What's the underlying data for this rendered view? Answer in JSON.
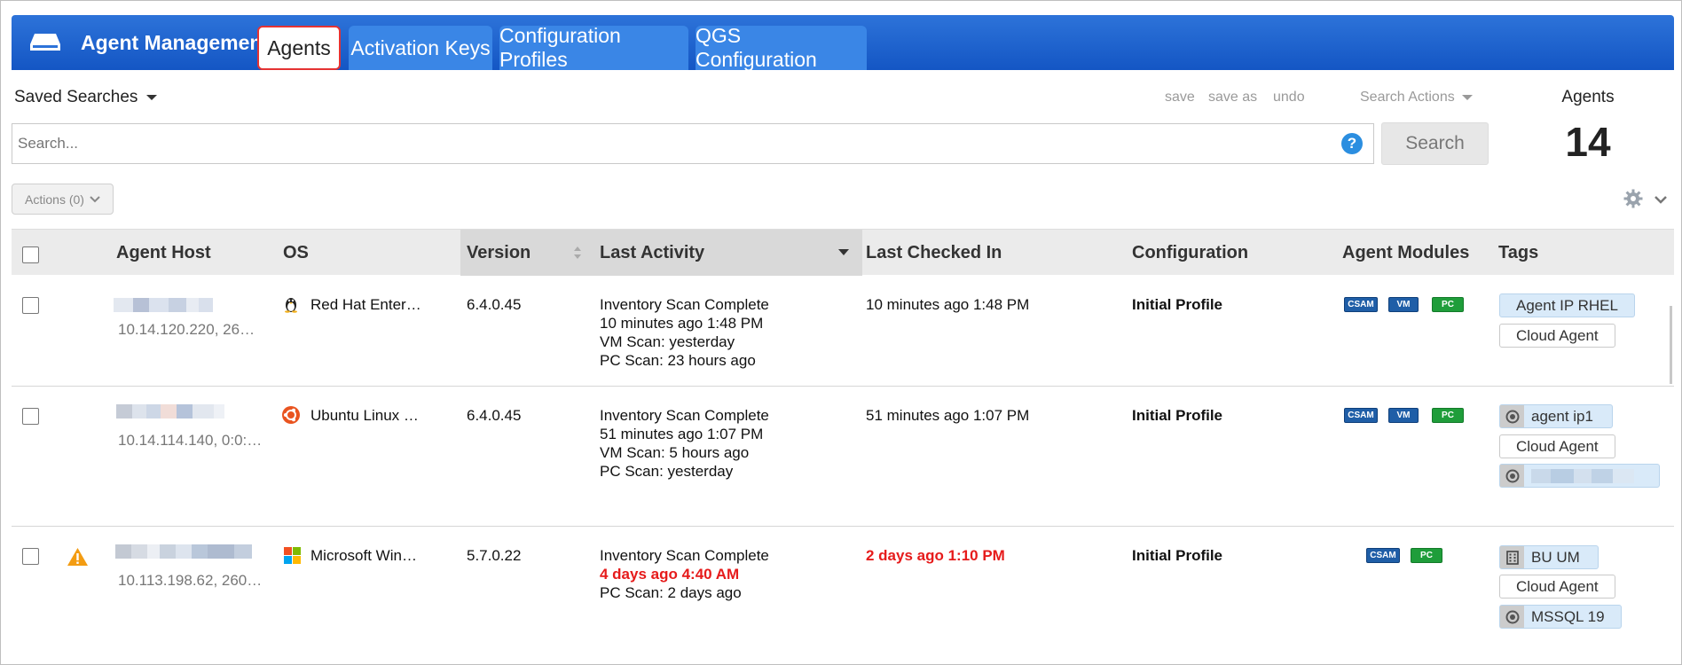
{
  "header": {
    "app_title": "Agent Management",
    "tabs": [
      {
        "label": "Agents",
        "active": true
      },
      {
        "label": "Activation Keys"
      },
      {
        "label": "Configuration Profiles"
      },
      {
        "label": "QGS Configuration"
      }
    ],
    "brand_color": "#1a5fcf",
    "logo_icon": "device-icon"
  },
  "toolbar": {
    "saved_searches": "Saved Searches",
    "save": "save",
    "save_as": "save as",
    "undo": "undo",
    "search_actions": "Search Actions",
    "search_placeholder": "Search...",
    "search_button": "Search",
    "actions_button": "Actions (0)",
    "help_glyph": "?"
  },
  "summary": {
    "agents_label": "Agents",
    "agents_count": "14"
  },
  "table": {
    "columns": [
      "Agent Host",
      "OS",
      "Version",
      "Last Activity",
      "Last Checked In",
      "Configuration",
      "Agent Modules",
      "Tags"
    ],
    "sorted_column": "Last Activity",
    "rows": [
      {
        "host_ip": "10.14.120.220, 26…",
        "warning": false,
        "os_icon": "linux-tux-icon",
        "os": "Red Hat Enter…",
        "version": "6.4.0.45",
        "activity": [
          "Inventory Scan Complete",
          "10 minutes ago 1:48 PM",
          "VM Scan: yesterday",
          "PC Scan: 23 hours ago"
        ],
        "checked_in": "10 minutes ago 1:48 PM",
        "checked_in_stale": false,
        "configuration": "Initial Profile",
        "modules": [
          "CSAM",
          "VM",
          "PC"
        ],
        "tags": [
          "Agent IP RHEL",
          "Cloud Agent"
        ]
      },
      {
        "host_ip": "10.14.114.140, 0:0:…",
        "warning": false,
        "os_icon": "ubuntu-icon",
        "os": "Ubuntu Linux …",
        "version": "6.4.0.45",
        "activity": [
          "Inventory Scan Complete",
          "51 minutes ago 1:07 PM",
          "VM Scan: 5 hours ago",
          "PC Scan: yesterday"
        ],
        "checked_in": "51 minutes ago 1:07 PM",
        "checked_in_stale": false,
        "configuration": "Initial Profile",
        "modules": [
          "CSAM",
          "VM",
          "PC"
        ],
        "tags": [
          "agent ip1",
          "Cloud Agent"
        ]
      },
      {
        "host_ip": "10.113.198.62, 260…",
        "warning": true,
        "os_icon": "windows-icon",
        "os": "Microsoft Win…",
        "version": "5.7.0.22",
        "activity": [
          "Inventory Scan Complete",
          "4 days ago 4:40 AM",
          "PC Scan: 2 days ago"
        ],
        "checked_in": "2 days ago 1:10 PM",
        "checked_in_stale": true,
        "configuration": "Initial Profile",
        "modules": [
          "CSAM",
          "PC"
        ],
        "tags": [
          "BU UM",
          "Cloud Agent",
          "MSSQL 19"
        ]
      }
    ]
  },
  "colors": {
    "stale": "#e61b1b",
    "module_blue": "#1f5ea7",
    "module_green": "#1f9d3a",
    "tag_blue": "#d9eaf9"
  }
}
